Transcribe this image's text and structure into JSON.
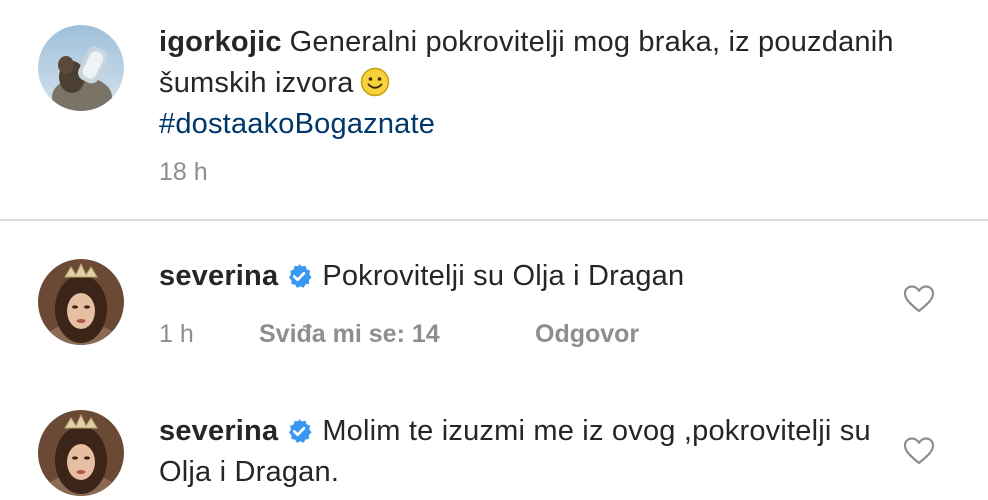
{
  "caption": {
    "username": "igorkojic",
    "text": "Generalni pokrovitelji mog braka, iz pouzdanih šumskih izvora",
    "emoji": "smiling-face-icon",
    "hashtag": "#dostaakoBogaznate",
    "time": "18 h"
  },
  "comments": [
    {
      "username": "severina",
      "verified": true,
      "text": "Pokrovitelji su Olja i Dragan",
      "time": "1 h",
      "likes_label": "Sviđa mi se: 14",
      "reply_label": "Odgovor"
    },
    {
      "username": "severina",
      "verified": true,
      "text": "Molim te izuzmi me iz ovog ,pokrovitelji su Olja i Dragan."
    }
  ],
  "colors": {
    "text": "#262626",
    "meta": "#8e8e8e",
    "hashtag": "#00376b",
    "verified": "#3897f0",
    "divider": "#dbdbdb"
  }
}
